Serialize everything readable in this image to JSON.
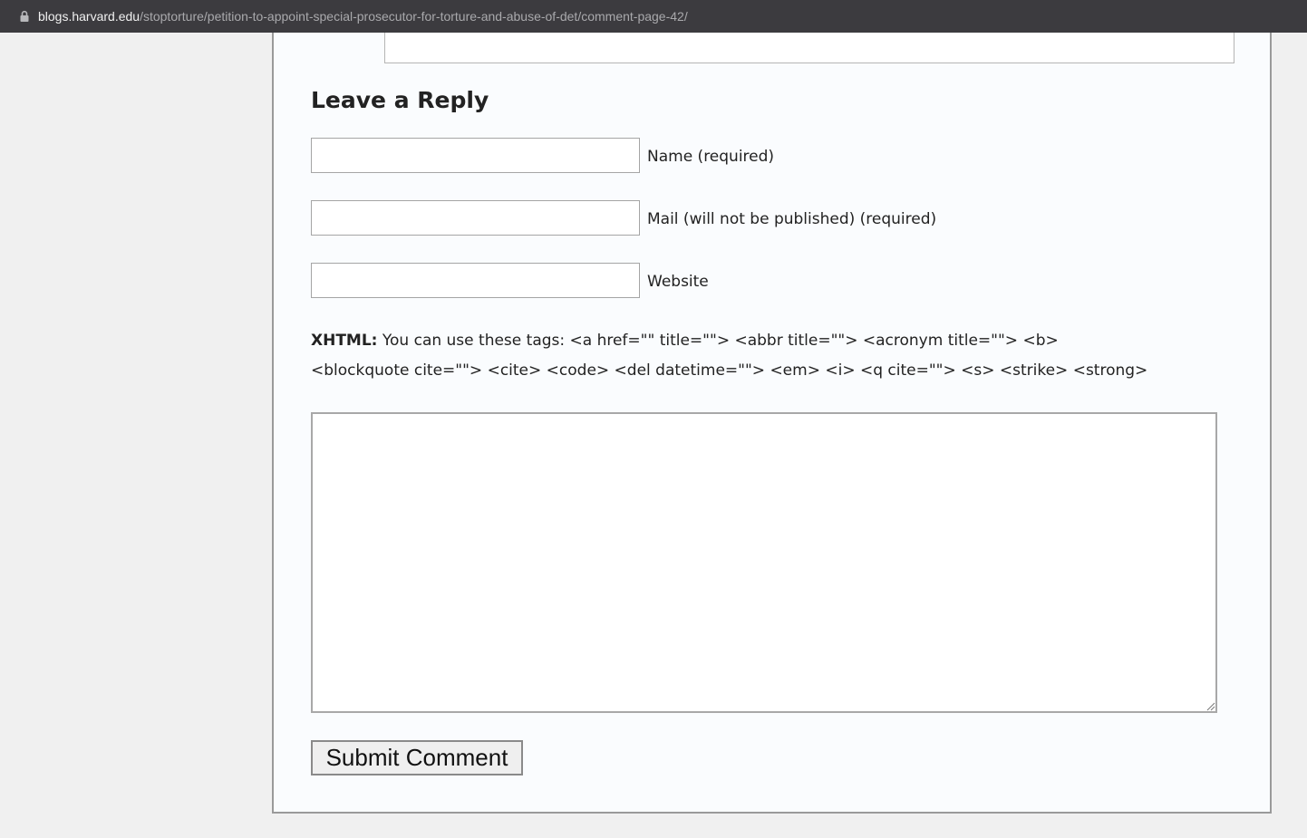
{
  "browser": {
    "url_host": "blogs.harvard.edu",
    "url_path": "/stoptorture/petition-to-appoint-special-prosecutor-for-torture-and-abuse-of-det/comment-page-42/",
    "lock_icon": "lock-icon"
  },
  "reply": {
    "heading": "Leave a Reply",
    "name_label": "Name (required)",
    "name_value": "",
    "mail_label": "Mail (will not be published) (required)",
    "mail_value": "",
    "website_label": "Website",
    "website_value": "",
    "xhtml_label": "XHTML:",
    "tags_line1": " You can use these tags: <a href=\"\" title=\"\"> <abbr title=\"\"> <acronym title=\"\"> <b>",
    "tags_line2": "<blockquote cite=\"\"> <cite> <code> <del datetime=\"\"> <em> <i> <q cite=\"\"> <s> <strike> <strong>",
    "comment_value": "",
    "submit_label": "Submit Comment"
  }
}
